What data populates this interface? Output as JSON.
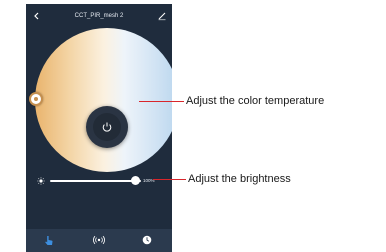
{
  "header": {
    "title": "CCT_PIR_mesh 2",
    "back_icon": "chevron-left-icon",
    "edit_icon": "pencil-icon"
  },
  "color_wheel": {
    "warm_color": "#e9b46d",
    "cool_color": "#b9d6ee",
    "power_icon": "power-icon"
  },
  "brightness": {
    "value_label": "100%",
    "level": 1.0,
    "icon": "sun-icon"
  },
  "tabbar": {
    "tabs": [
      {
        "icon": "hand-pointer-icon",
        "active": true,
        "color": "#3d8fe0"
      },
      {
        "icon": "radar-icon",
        "active": false,
        "color": "#ffffff"
      },
      {
        "icon": "clock-icon",
        "active": false,
        "color": "#ffffff"
      }
    ]
  },
  "callouts": {
    "color_temperature": "Adjust the color temperature",
    "brightness": "Adjust the brightness",
    "line_color": "#d9262b"
  },
  "colors": {
    "screen_bg": "#1f2c3d",
    "tabbar_bg": "#2b3a4e"
  }
}
